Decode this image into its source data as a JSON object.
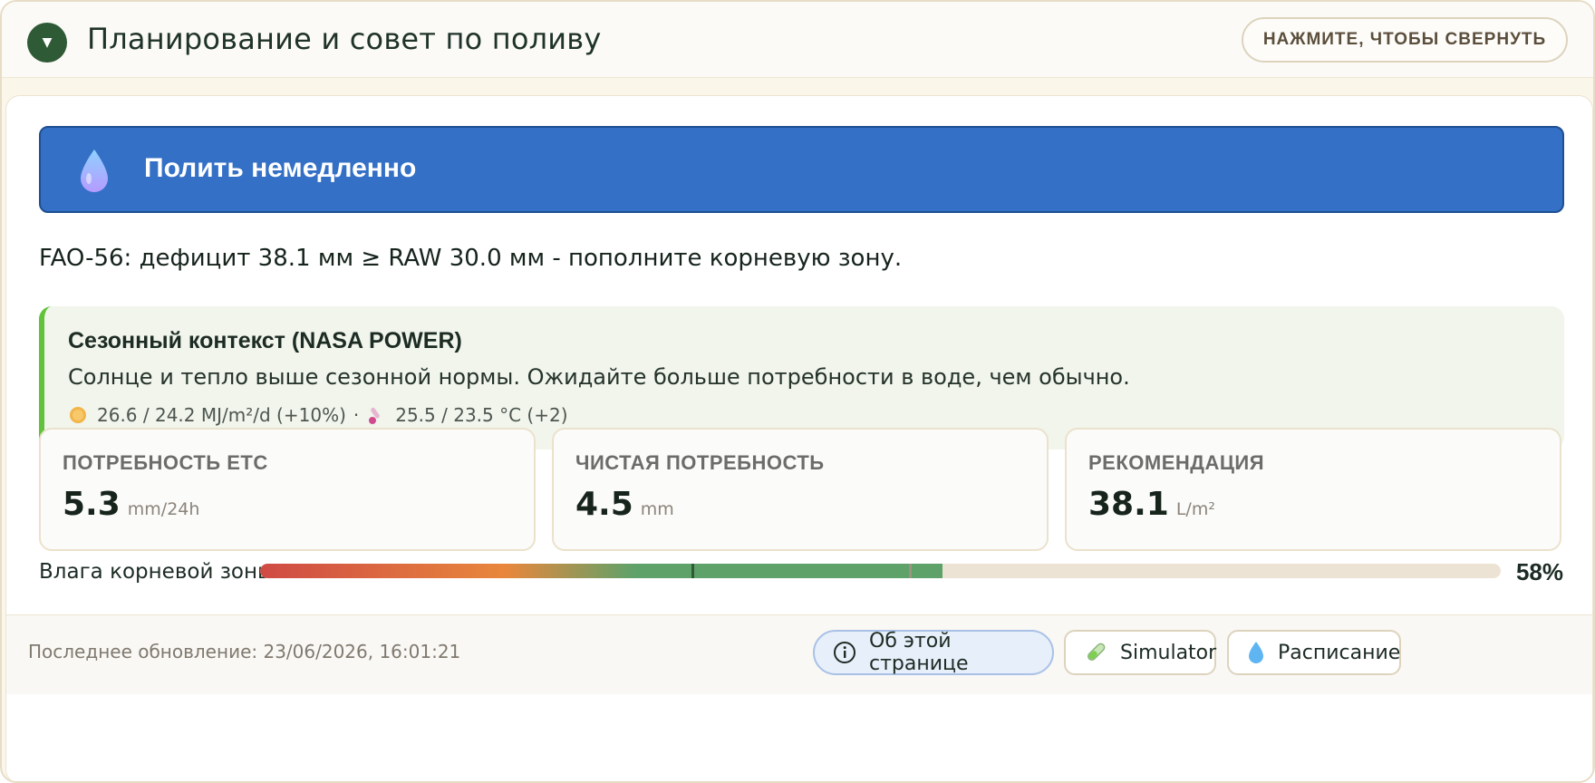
{
  "header": {
    "title": "Планирование и совет по поливу",
    "collapse_label": "НАЖМИТЕ, ЧТОБЫ СВЕРНУТЬ"
  },
  "alert": {
    "text": "Полить немедленно",
    "icon": "water-drop-icon",
    "color": "#3470c6"
  },
  "fao_message": "FAO-56: дефицит 38.1 мм ≥ RAW 30.0 мм - пополните корневую зону.",
  "season": {
    "title": "Сезонный контекст (NASA POWER)",
    "description": "Солнце и тепло выше сезонной нормы. Ожидайте больше потребности в воде, чем обычно.",
    "solar": "26.6 / 24.2 MJ/m²/d (+10%)",
    "separator": "·",
    "temperature": "25.5 / 23.5 °C (+2)",
    "solar_icon": "sun-icon",
    "temperature_icon": "thermometer-icon",
    "accent": "#62c23c"
  },
  "stats": [
    {
      "label": "ПОТРЕБНОСТЬ ETC",
      "value": "5.3",
      "unit": "mm/24h"
    },
    {
      "label": "ЧИСТАЯ ПОТРЕБНОСТЬ",
      "value": "4.5",
      "unit": "mm"
    },
    {
      "label": "РЕКОМЕНДАЦИЯ",
      "value": "38.1",
      "unit": "L/m²"
    }
  ],
  "moisture": {
    "label": "Влага корневой зоны",
    "percent_text": "58%",
    "fill_fraction": 0.55,
    "markers": [
      0.348,
      0.523
    ]
  },
  "footer": {
    "last_update": "Последнее обновление: 23/06/2026, 16:01:21",
    "buttons": {
      "about": "Об этой странице",
      "simulator": "Simulator",
      "schedule": "Расписание"
    }
  }
}
